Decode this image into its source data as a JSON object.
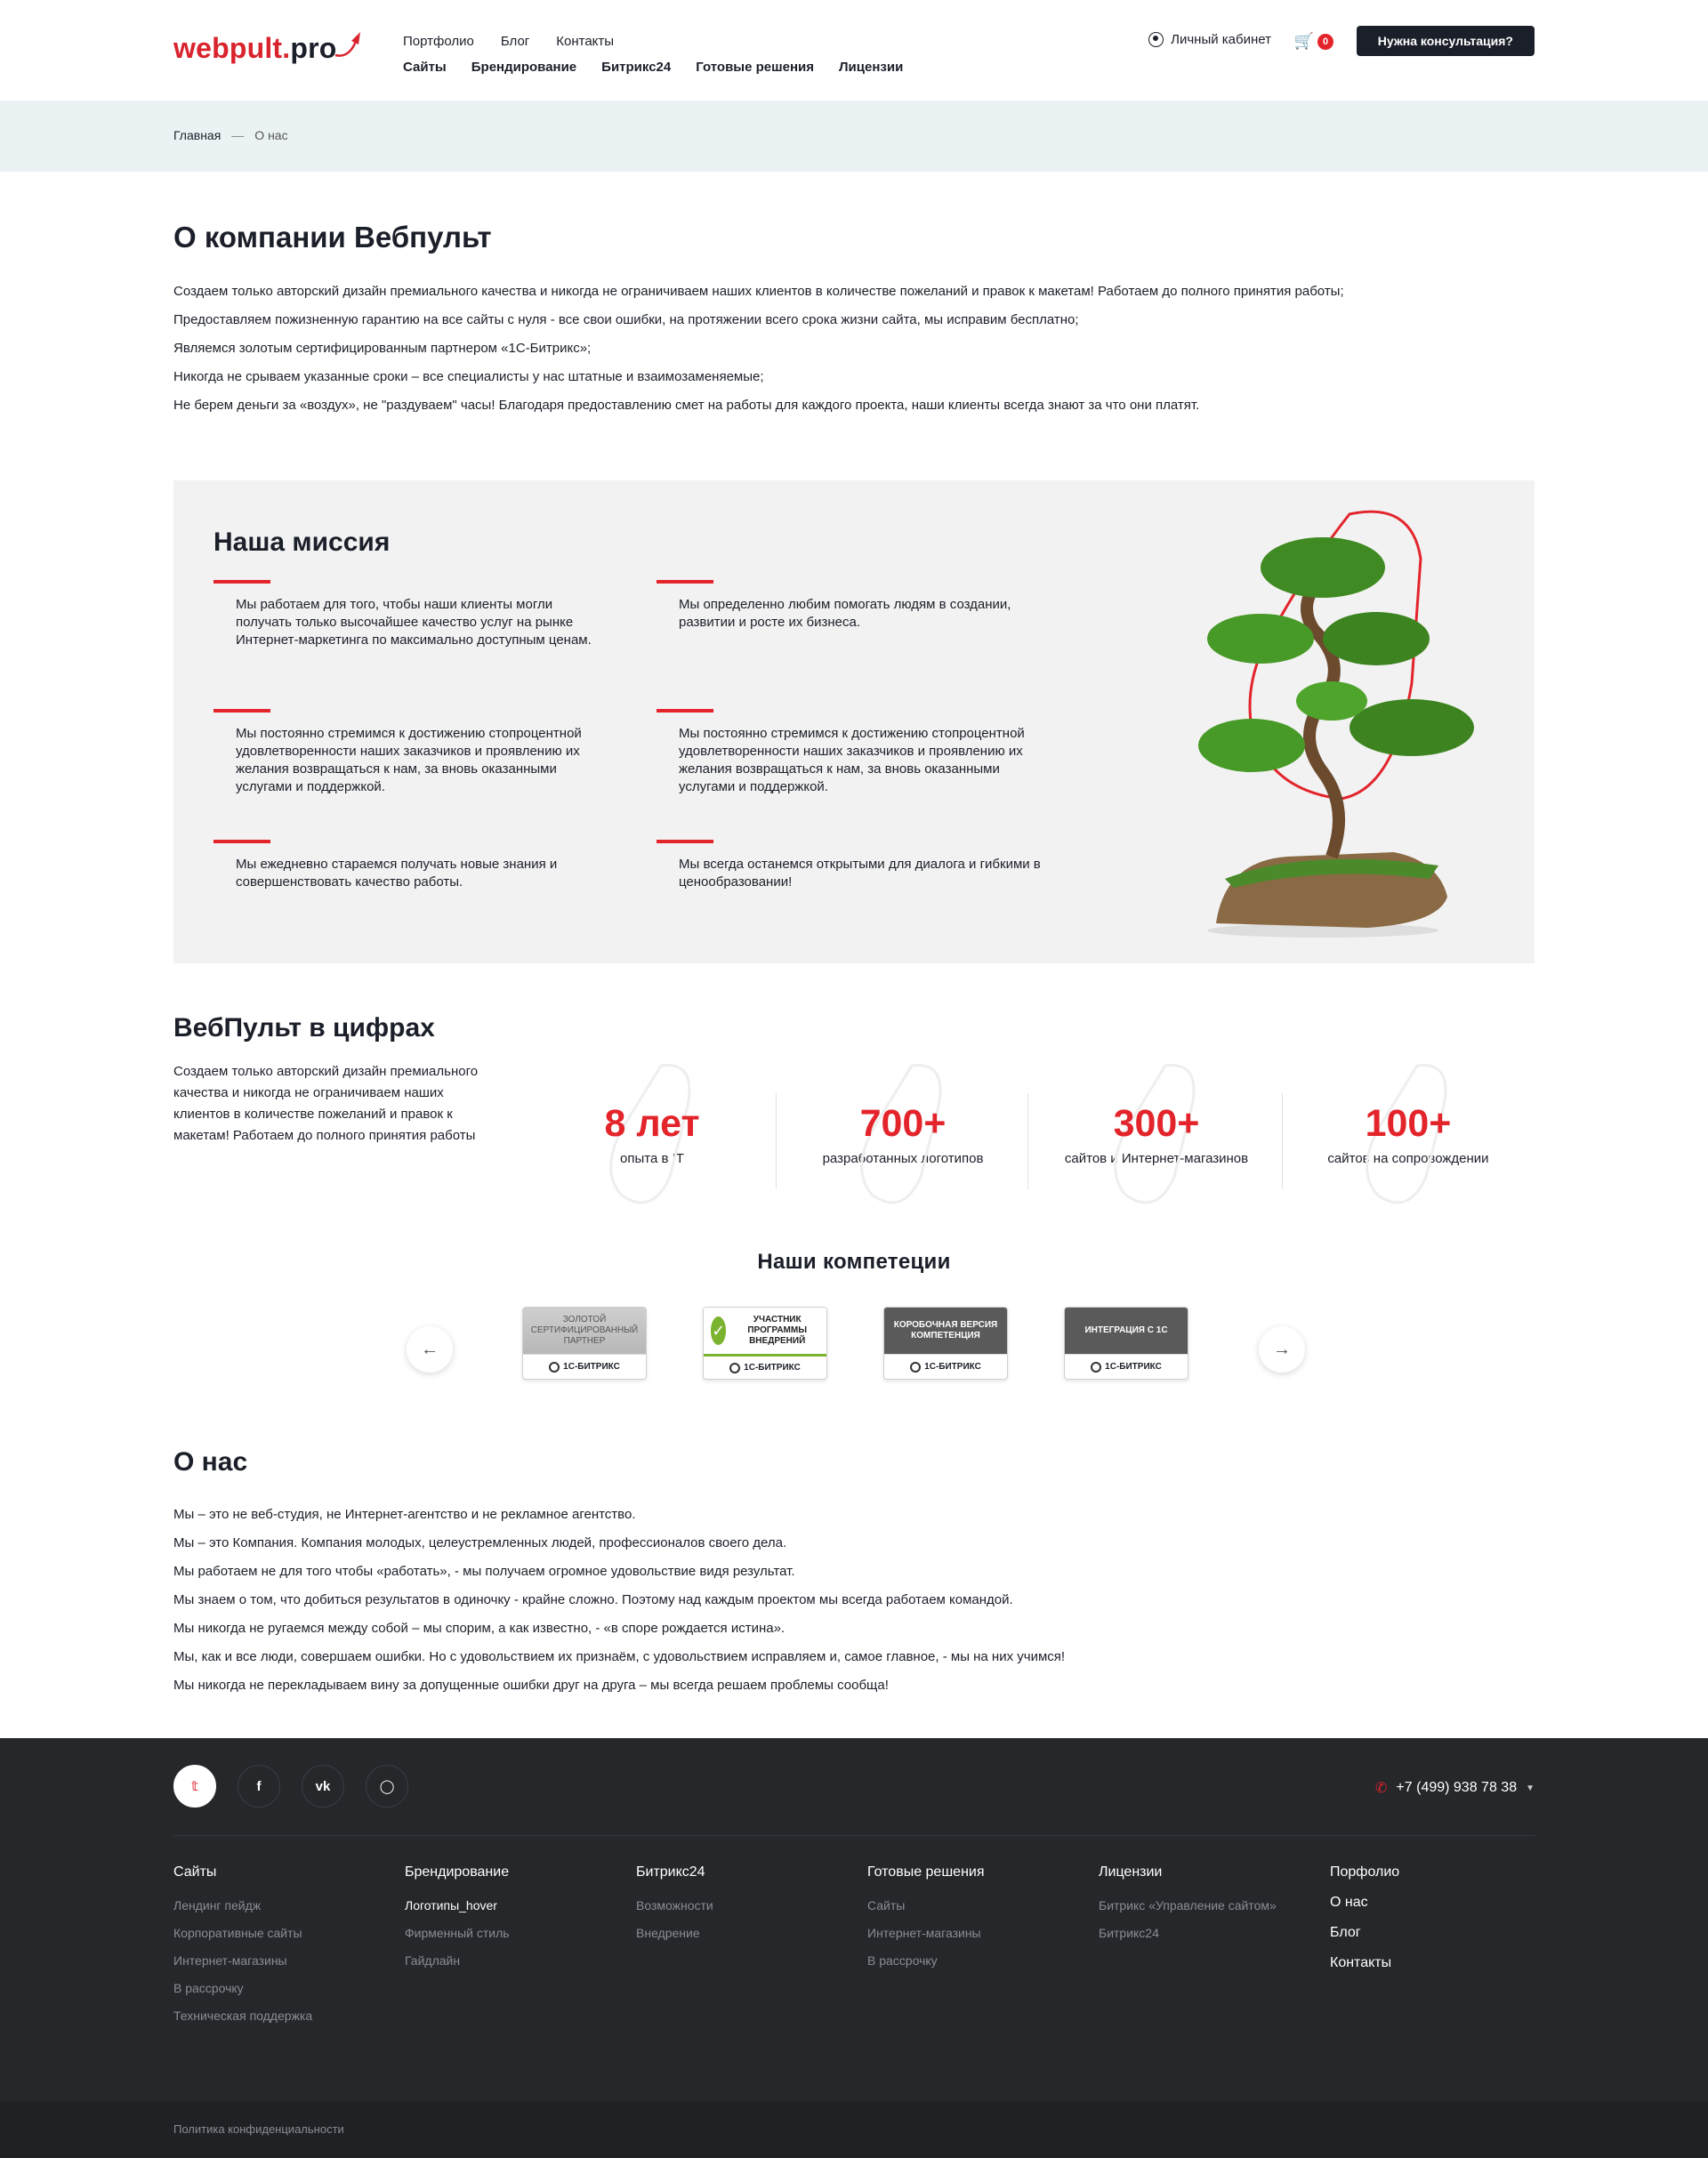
{
  "header": {
    "logo_main": "webpult.",
    "logo_pro": "pro",
    "top_links": [
      "Портфолио",
      "Блог",
      "Контакты"
    ],
    "main_links": [
      "Сайты",
      "Брендирование",
      "Битрикс24",
      "Готовые решения",
      "Лицензии"
    ],
    "cabinet": "Личный кабинет",
    "cart_count": "0",
    "consult_button": "Нужна консультация?"
  },
  "breadcrumbs": {
    "home": "Главная",
    "separator": "—",
    "current": "О нас"
  },
  "page_title": "О компании Вебпульт",
  "intro": [
    "Создаем только авторский дизайн премиального качества и никогда не ограничиваем наших клиентов в количестве пожеланий и правок к макетам! Работаем до полного принятия работы;",
    "Предоставляем пожизненную гарантию на все сайты с нуля - все свои ошибки, на протяжении всего срока жизни сайта, мы исправим бесплатно;",
    "Являемся золотым сертифицированным партнером «1С-Битрикс»;",
    "Никогда не срываем указанные сроки – все специалисты у нас штатные и взаимозаменяемые;",
    "Не берем деньги за «воздух», не \"раздуваем\" часы! Благодаря предоставлению смет на работы для каждого проекта, наши клиенты всегда знают за что они платят."
  ],
  "mission": {
    "title": "Наша миссия",
    "items": [
      "Мы работаем для того, чтобы наши клиенты могли получать только высочайшее качество услуг на рынке Интернет-маркетинга по максимально доступным ценам.",
      "Мы определенно любим помогать людям в создании, развитии и росте их бизнеса.",
      "Мы постоянно стремимся к достижению стопроцентной удовлетворенности наших заказчиков и проявлению их желания возвращаться к нам, за вновь оказанными услугами и поддержкой.",
      "Мы постоянно стремимся к достижению стопроцентной удовлетворенности наших заказчиков и проявлению их желания возвращаться к нам, за вновь оказанными услугами и поддержкой.",
      "Мы ежедневно стараемся получать новые знания и совершенствовать качество работы.",
      "Мы всегда останемся открытыми для диалога и гибкими в ценообразовании!"
    ]
  },
  "numbers": {
    "title": "ВебПульт в цифрах",
    "text": "Создаем только авторский дизайн премиального качества и никогда не ограничиваем наших клиентов в количестве пожеланий и правок к макетам! Работаем до полного принятия работы",
    "stats": [
      {
        "value": "8 лет",
        "label": "опыта в IT"
      },
      {
        "value": "700+",
        "label": "разработанных логотипов"
      },
      {
        "value": "300+",
        "label": "сайтов и Интернет-магазинов"
      },
      {
        "value": "100+",
        "label": "сайтов на сопровождении"
      }
    ]
  },
  "competences": {
    "title": "Наши компетеции",
    "badges": [
      {
        "head": "ЗОЛОТОЙ СЕРТИФИЦИРОВАННЫЙ ПАРТНЕР",
        "brand": "1С-БИТРИКС"
      },
      {
        "head": "УЧАСТНИК ПРОГРАММЫ ВНЕДРЕНИЙ",
        "brand": "1С-БИТРИКС"
      },
      {
        "head": "КОРОБОЧНАЯ ВЕРСИЯ КОМПЕТЕНЦИЯ",
        "brand": "1С-БИТРИКС"
      },
      {
        "head": "ИНТЕГРАЦИЯ С 1С",
        "brand": "1С-БИТРИКС"
      }
    ]
  },
  "about": {
    "title": "О нас",
    "lines": [
      "Мы – это не веб-студия, не Интернет-агентство и не рекламное агентство.",
      "Мы – это Компания. Компания молодых, целеустремленных людей, профессионалов своего дела.",
      "Мы работаем не для того чтобы «работать», - мы получаем огромное удовольствие видя результат.",
      "Мы знаем о том, что добиться результатов в одиночку - крайне сложно. Поэтому над каждым проектом мы всегда работаем командой.",
      "Мы никогда не ругаемся между собой – мы спорим, а как известно, - «в споре рождается истина».",
      "Мы, как и все люди, совершаем ошибки. Но с удовольствием их признаём, с удовольствием исправляем и, самое главное, - мы на них учимся!",
      "Мы никогда не перекладываем вину за допущенные ошибки друг на друга – мы всегда решаем проблемы сообща!"
    ]
  },
  "footer": {
    "phone": "+7 (499) 938 78 38",
    "columns": [
      {
        "title": "Сайты",
        "links": [
          "Лендинг пейдж",
          "Корпоративные сайты",
          "Интернет-магазины",
          "В рассрочку",
          "Техническая поддержка"
        ]
      },
      {
        "title": "Брендирование",
        "links": [
          "Логотипы_hover",
          "Фирменный стиль",
          "Гайдлайн"
        ]
      },
      {
        "title": "Битрикс24",
        "links": [
          "Возможности",
          "Внедрение"
        ]
      },
      {
        "title": "Готовые решения",
        "links": [
          "Сайты",
          "Интернет-магазины",
          "В рассрочку"
        ]
      },
      {
        "title": "Лицензии",
        "links": [
          "Битрикс «Управление сайтом»",
          "Битрикс24"
        ]
      }
    ],
    "extra_links": [
      "Порфолио",
      "О нас",
      "Блог",
      "Контакты"
    ],
    "privacy": "Политика конфиденциальности"
  },
  "colors": {
    "accent": "#e3242b",
    "dark": "#1b1f29",
    "footer_bg": "#25272b",
    "breadcrumb_bg": "#ebf2f4",
    "mission_bg": "#f2f2f2"
  }
}
